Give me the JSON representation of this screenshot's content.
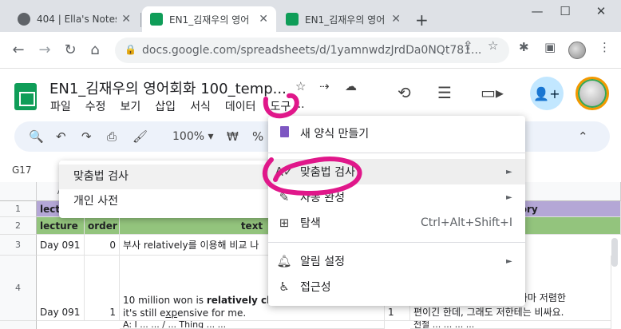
{
  "browser": {
    "tabs": [
      {
        "title": "404 | Ella's Notes",
        "close": "✕"
      },
      {
        "title": "EN1_김재우의 영어",
        "close": "✕"
      },
      {
        "title": "EN1_김재우의 영어",
        "close": "✕"
      }
    ],
    "new_tab": "+",
    "window_controls": {
      "minimize": "—",
      "maximize": "☐",
      "close": "✕"
    },
    "url": "docs.google.com/spreadsheets/d/1yamnwdzJrdDa0NQt781..."
  },
  "sheet": {
    "title": "EN1_김재우의 영어회화 100_temp...",
    "menu": [
      "파일",
      "수정",
      "보기",
      "삽입",
      "서식",
      "데이터",
      "도구",
      "..."
    ],
    "zoom": "100%",
    "currency": "₩",
    "percent": "%",
    "name_box": "G17"
  },
  "grid": {
    "col_a_label": "A",
    "row_numbers": [
      "1",
      "2",
      "3",
      "4"
    ],
    "row1": {
      "a": "lecture",
      "right": "tory"
    },
    "row2": {
      "a": "lecture",
      "b": "order",
      "c": "text",
      "right": "t"
    },
    "row3": {
      "a": "Day 091",
      "b": "0",
      "c": "부사 relatively를 이용해 비교 나"
    },
    "row4": {
      "a": "Day 091",
      "b": "1",
      "c_line1_pre": "10 million won is ",
      "c_line1_bold": "relatively che",
      "c_line2_pre": "it's still e",
      "c_line2_ul": "xp",
      "c_line2_post": "ensive for me.",
      "d": "1",
      "right_line1": "는 그나마 저렴한",
      "right_line2": "편이긴 한데, 그래도 저한테는 비싸요."
    },
    "row5": {
      "c": "A: I ... ... / ... Thing ... ...",
      "right": "전철 ... ... ... ..."
    }
  },
  "submenu": {
    "items": [
      "맞춤법 검사",
      "개인 사전"
    ]
  },
  "tools_menu": {
    "items": [
      {
        "icon": "form-icon",
        "label": "새 양식 만들기"
      },
      {
        "icon": "spellcheck-icon",
        "label": "맞춤법 검사",
        "arrow": "►"
      },
      {
        "icon": "autocomplete-icon",
        "label": "자동 완성",
        "arrow": "►"
      },
      {
        "icon": "explore-icon",
        "label": "탐색",
        "shortcut": "Ctrl+Alt+Shift+I"
      },
      {
        "icon": "bell-icon",
        "label": "알림 설정",
        "arrow": "►"
      },
      {
        "icon": "accessibility-icon",
        "label": "접근성"
      }
    ]
  },
  "colors": {
    "sheets_green": "#0f9d58",
    "header_purple": "#b4a7d6",
    "header_green": "#93c47d",
    "annotation_pink": "#e0178a",
    "menu_highlight": "#eeeeee"
  }
}
